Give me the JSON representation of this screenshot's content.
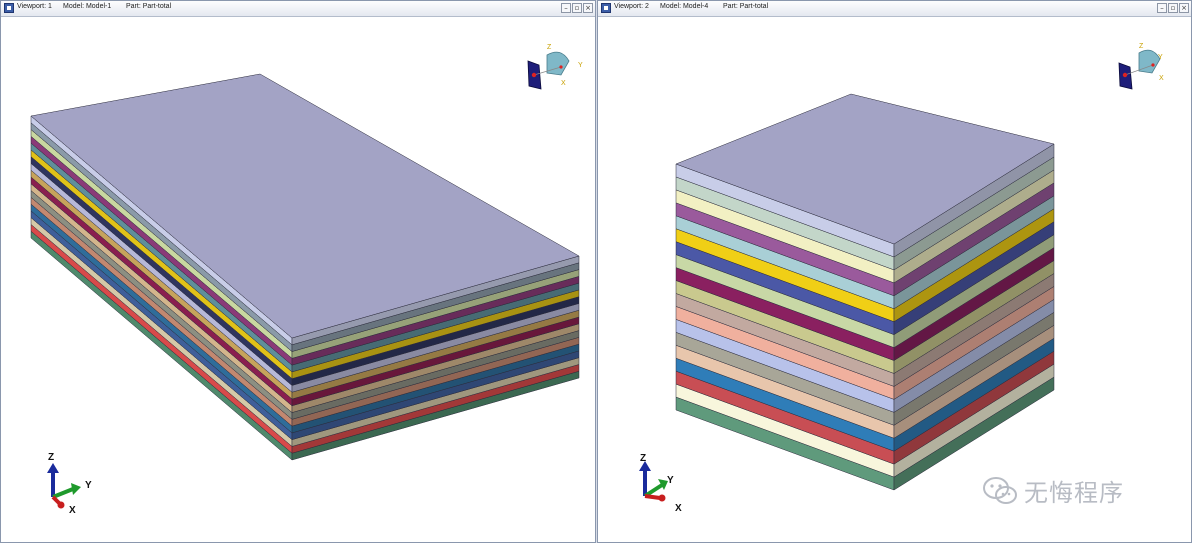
{
  "viewport1": {
    "viewport_label": "Viewport: 1",
    "model_label": "Model: Model-1",
    "part_label": "Part: Part-total",
    "triad": {
      "z": "Z",
      "y": "Y",
      "x": "X"
    }
  },
  "viewport2": {
    "viewport_label": "Viewport: 2",
    "model_label": "Model: Model-4",
    "part_label": "Part: Part-total",
    "triad": {
      "z": "Z",
      "y": "Y",
      "x": "X"
    }
  },
  "window_buttons": {
    "minimize": "–",
    "restore": "▫",
    "close": "×"
  },
  "view_cube_axes": {
    "z": "Z",
    "y": "Y",
    "x": "X"
  },
  "watermark": {
    "text": "无悔程序"
  },
  "colors": {
    "top_face": "#a3a3c5",
    "layers_model1": [
      "#c8cde8",
      "#8a9aa8",
      "#c9d8a0",
      "#8a3a78",
      "#5f8f9a",
      "#e0c218",
      "#2f355e",
      "#b6b8d8",
      "#c7a35b",
      "#8a1e4f",
      "#d3b58c",
      "#8c8f82",
      "#c28870",
      "#2f6d9a",
      "#3f5f9a",
      "#d4c9a8",
      "#d84a4a",
      "#4f8a6c"
    ],
    "layers_model4": [
      "#c8cde8",
      "#c3d6c9",
      "#f2f0c3",
      "#9a5a9c",
      "#a9cfd6",
      "#f0cf16",
      "#4b58a6",
      "#c8d8a6",
      "#8a2060",
      "#c9c98e",
      "#c2a9a0",
      "#f0b09e",
      "#b8c2ea",
      "#a8a698",
      "#e8c6ac",
      "#2f7db8",
      "#c84e54",
      "#f8f6dc",
      "#5f9a7c"
    ]
  }
}
